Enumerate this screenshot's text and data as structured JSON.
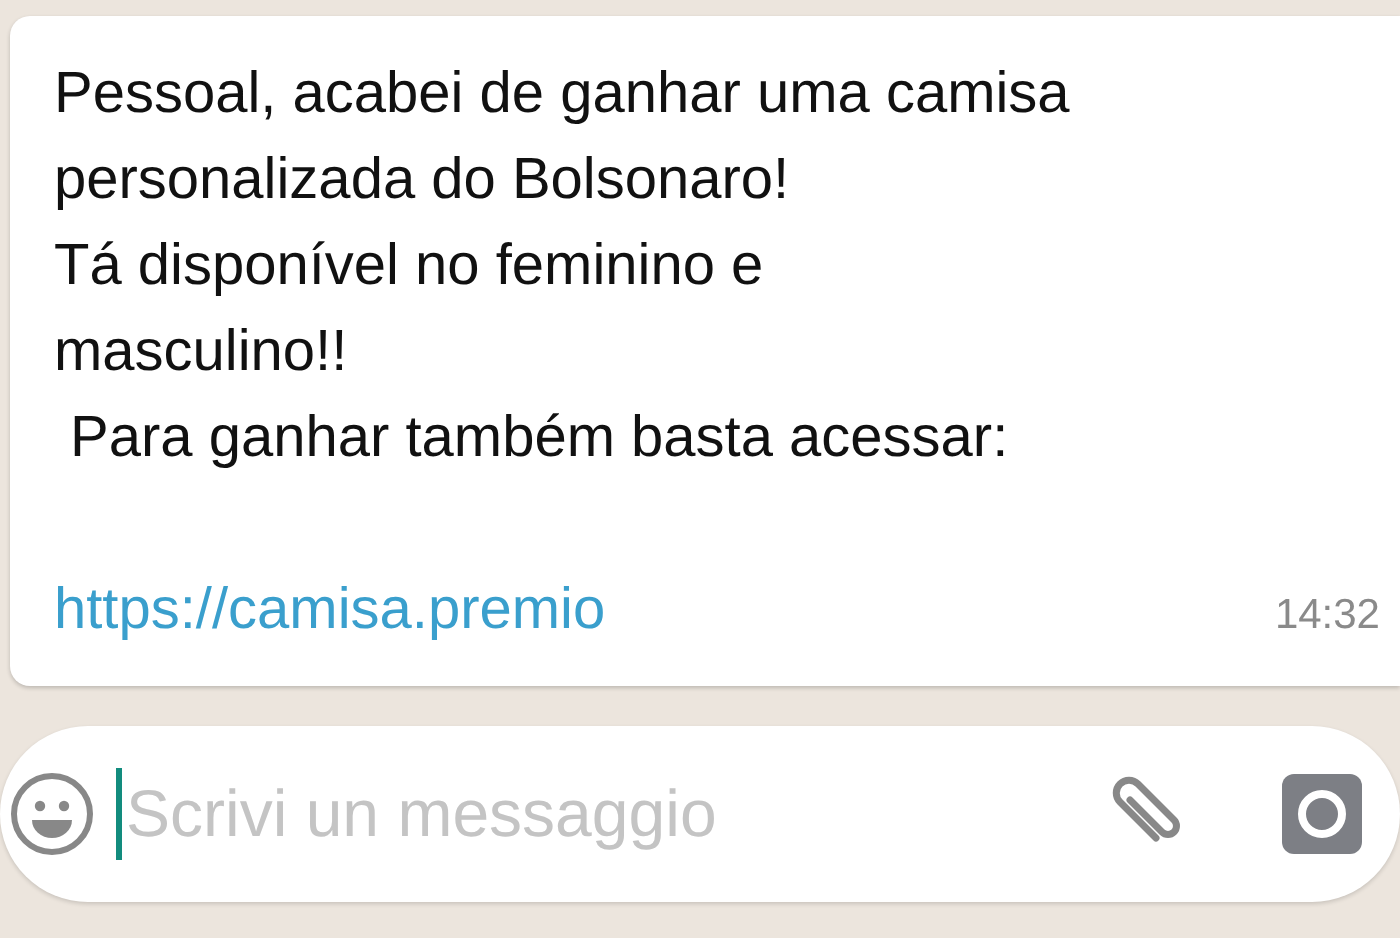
{
  "message": {
    "lines": [
      "Pessoal, acabei de ganhar uma camisa",
      "personalizada do Bolsonaro!",
      "Tá disponível no feminino e",
      "masculino!!",
      " Para ganhar também basta acessar:"
    ],
    "link": "https://camisa.premio",
    "time": "14:32"
  },
  "composer": {
    "placeholder": "Scrivi un messaggio"
  }
}
